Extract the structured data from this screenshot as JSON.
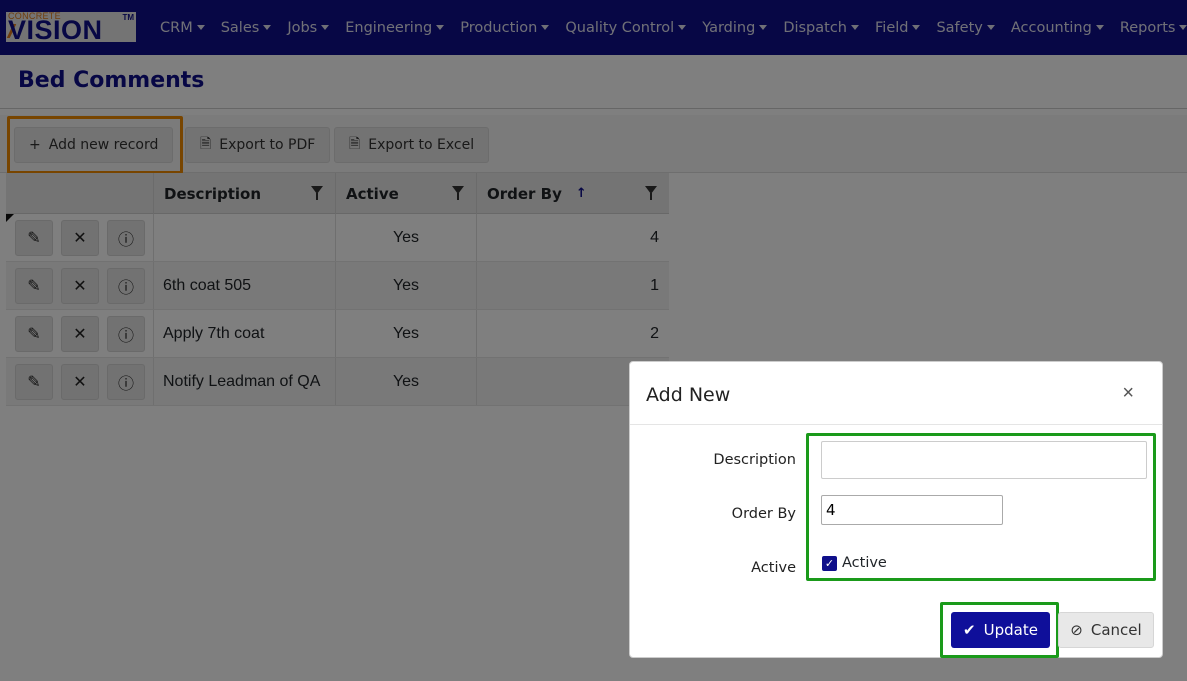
{
  "brand": {
    "logo_top": "CONCRETE",
    "logo_main": "VISION",
    "logo_tm": "TM"
  },
  "nav": {
    "items": [
      {
        "label": "CRM"
      },
      {
        "label": "Sales"
      },
      {
        "label": "Jobs"
      },
      {
        "label": "Engineering"
      },
      {
        "label": "Production"
      },
      {
        "label": "Quality Control"
      },
      {
        "label": "Yarding"
      },
      {
        "label": "Dispatch"
      },
      {
        "label": "Field"
      },
      {
        "label": "Safety"
      },
      {
        "label": "Accounting"
      },
      {
        "label": "Reports"
      }
    ]
  },
  "page": {
    "title": "Bed Comments"
  },
  "toolbar": {
    "add_label": "Add new record",
    "pdf_label": "Export to PDF",
    "excel_label": "Export to Excel"
  },
  "grid": {
    "columns": {
      "description": "Description",
      "active": "Active",
      "order_by": "Order By"
    },
    "rows": [
      {
        "description": "",
        "active": "Yes",
        "order_by": "4"
      },
      {
        "description": "6th coat 505",
        "active": "Yes",
        "order_by": "1"
      },
      {
        "description": "Apply 7th coat",
        "active": "Yes",
        "order_by": "2"
      },
      {
        "description": "Notify Leadman of QA",
        "active": "Yes",
        "order_by": ""
      }
    ]
  },
  "dialog": {
    "title": "Add New",
    "close_glyph": "×",
    "description_label": "Description",
    "description_value": "",
    "order_by_label": "Order By",
    "order_by_value": "4",
    "active_label": "Active",
    "active_checkbox_label": "Active",
    "active_checked": true,
    "update_label": "Update",
    "cancel_label": "Cancel"
  },
  "colors": {
    "navbar": "#0f0f8a",
    "highlight_orange": "#f08a00",
    "highlight_green": "#1a9a1a"
  }
}
